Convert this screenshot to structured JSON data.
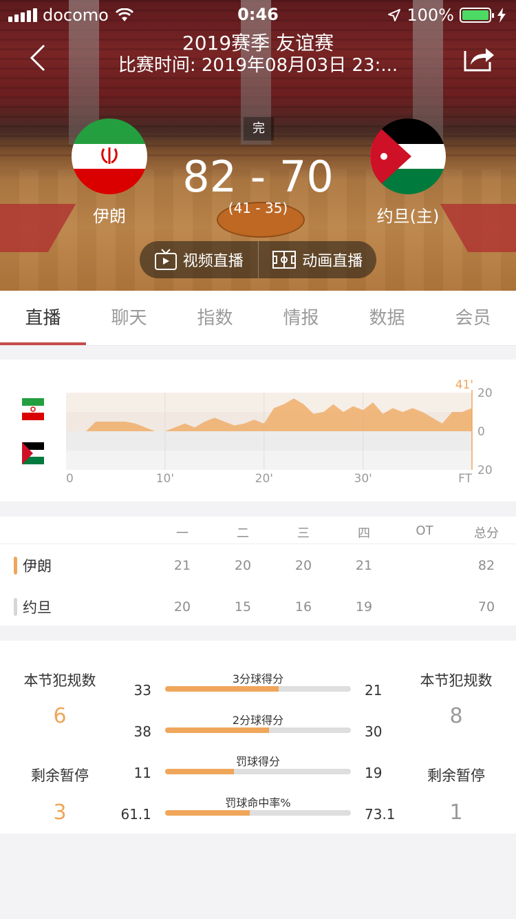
{
  "statusbar": {
    "carrier": "docomo",
    "time": "0:46",
    "battery": "100%"
  },
  "header": {
    "title": "2019赛季 友谊赛",
    "subtitle": "比赛时间: 2019年08月03日 23:...",
    "status_badge": "完",
    "score": "82 - 70",
    "half_score": "(41 - 35)",
    "team_left": "伊朗",
    "team_right": "约旦(主)",
    "video_live": "视频直播",
    "animation_live": "动画直播"
  },
  "tabs": [
    "直播",
    "聊天",
    "指数",
    "情报",
    "数据",
    "会员"
  ],
  "chart_data": {
    "type": "area",
    "x_ticks": [
      "0",
      "10'",
      "20'",
      "30'",
      "FT"
    ],
    "y_ticks": [
      "20",
      "0",
      "20"
    ],
    "ylim": [
      -20,
      20
    ],
    "current_minute_label": "41'",
    "accent": "#efa65b",
    "series": [
      {
        "x": [
          0,
          1,
          2,
          3,
          4,
          5,
          6,
          7,
          8,
          9,
          10,
          11,
          12,
          13,
          14,
          15,
          16,
          17,
          18,
          19,
          20,
          21,
          22,
          23,
          24,
          25,
          26,
          27,
          28,
          29,
          30,
          31,
          32,
          33,
          34,
          35,
          36,
          37,
          38,
          39,
          40,
          41
        ],
        "values": [
          0,
          0,
          0,
          5,
          5,
          5,
          5,
          4,
          2,
          0,
          0,
          2,
          4,
          2,
          5,
          7,
          5,
          3,
          4,
          6,
          4,
          12,
          14,
          17,
          14,
          9,
          10,
          14,
          10,
          13,
          11,
          15,
          9,
          12,
          10,
          12,
          10,
          7,
          4,
          10,
          10,
          12
        ]
      }
    ]
  },
  "quarters": {
    "headers": [
      "一",
      "二",
      "三",
      "四",
      "OT",
      "总分"
    ],
    "rows": [
      {
        "team": "伊朗",
        "color": "#efa65b",
        "scores": [
          "21",
          "20",
          "20",
          "21",
          "",
          "82"
        ]
      },
      {
        "team": "约旦",
        "color": "#d6d6d6",
        "scores": [
          "20",
          "15",
          "16",
          "19",
          "",
          "70"
        ]
      }
    ]
  },
  "stats": {
    "left_foul_label": "本节犯规数",
    "left_fouls": "6",
    "right_foul_label": "本节犯规数",
    "right_fouls": "8",
    "left_timeout_label": "剩余暂停",
    "left_timeouts": "3",
    "right_timeout_label": "剩余暂停",
    "right_timeouts": "1",
    "accent": "#efa65b",
    "items": [
      {
        "label": "3分球得分",
        "left": "33",
        "right": "21",
        "fill": 0.61
      },
      {
        "label": "2分球得分",
        "left": "38",
        "right": "30",
        "fill": 0.56
      },
      {
        "label": "罚球得分",
        "left": "11",
        "right": "19",
        "fill": 0.37
      },
      {
        "label": "罚球命中率%",
        "left": "61.1",
        "right": "73.1",
        "fill": 0.455
      }
    ]
  }
}
